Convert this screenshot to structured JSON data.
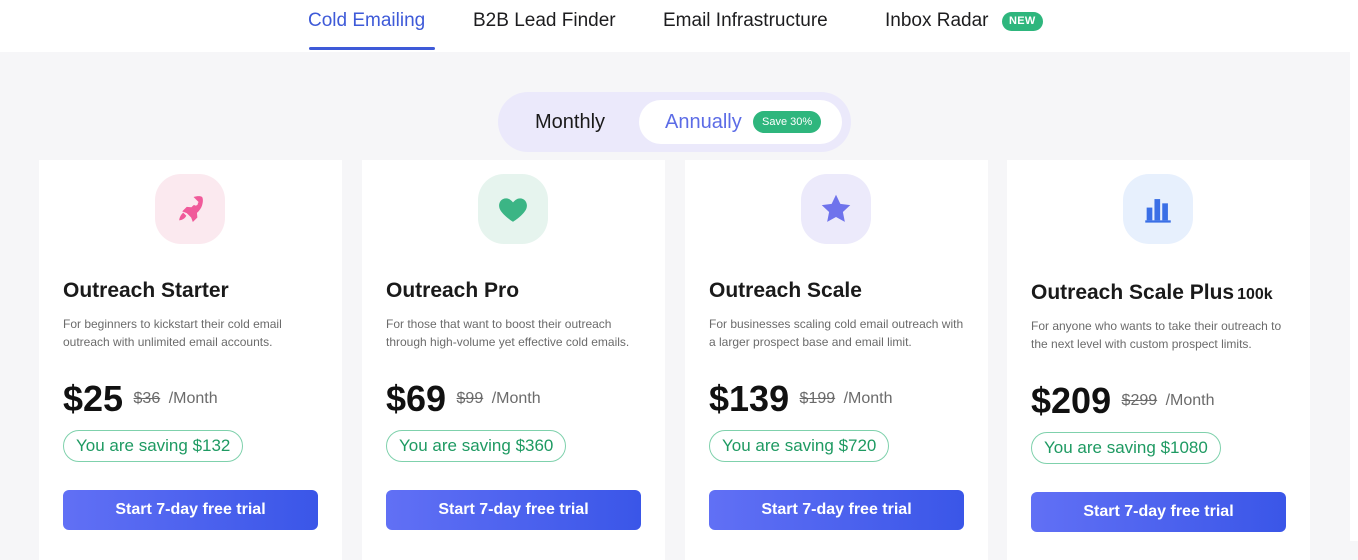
{
  "tabs": [
    {
      "label": "Cold Emailing",
      "active": true
    },
    {
      "label": "B2B Lead Finder",
      "active": false
    },
    {
      "label": "Email Infrastructure",
      "active": false
    },
    {
      "label": "Inbox Radar",
      "active": false,
      "badge": "NEW"
    }
  ],
  "billing_toggle": {
    "monthly_label": "Monthly",
    "annual_label": "Annually",
    "annual_badge": "Save 30%",
    "selected": "Annually"
  },
  "plans": [
    {
      "icon": "rocket-icon",
      "icon_color": "#f05a9a",
      "icon_bg": "#fbe9ef",
      "title": "Outreach Starter",
      "title_suffix": "",
      "description": "For beginners to kickstart their cold email outreach with unlimited email accounts.",
      "price": "$25",
      "old_price": "$36",
      "per": "/Month",
      "saving": "You are saving $132",
      "cta": "Start 7-day free trial"
    },
    {
      "icon": "heart-icon",
      "icon_color": "#3bb585",
      "icon_bg": "#e6f4ee",
      "title": "Outreach Pro",
      "title_suffix": "",
      "description": "For those that want to boost their outreach through high-volume yet effective cold emails.",
      "price": "$69",
      "old_price": "$99",
      "per": "/Month",
      "saving": "You are saving $360",
      "cta": "Start 7-day free trial"
    },
    {
      "icon": "star-icon",
      "icon_color": "#6f73ec",
      "icon_bg": "#eceafb",
      "title": "Outreach Scale",
      "title_suffix": "",
      "description": "For businesses scaling cold email outreach with a larger prospect base and email limit.",
      "price": "$139",
      "old_price": "$199",
      "per": "/Month",
      "saving": "You are saving $720",
      "cta": "Start 7-day free trial"
    },
    {
      "icon": "bar-chart-icon",
      "icon_color": "#3a6fe6",
      "icon_bg": "#e7f0fd",
      "title": "Outreach Scale Plus",
      "title_suffix": "100k",
      "description": "For anyone who wants to take their outreach to the next level with custom prospect limits.",
      "price": "$209",
      "old_price": "$299",
      "per": "/Month",
      "saving": "You are saving $1080",
      "cta": "Start 7-day free trial"
    }
  ]
}
